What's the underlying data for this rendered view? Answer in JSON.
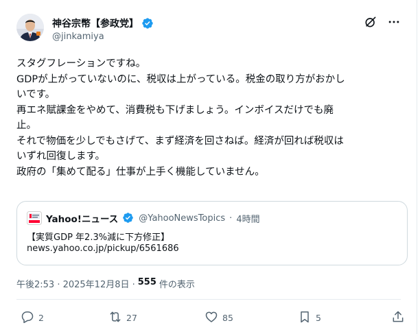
{
  "author": {
    "display_name": "神谷宗幣【参政党】",
    "handle": "@jinkamiya"
  },
  "tweet": {
    "lines": [
      "スタグフレーションですね。",
      "GDPが上がっていないのに、税収は上がっている。税金の取り方がおかし",
      "いです。",
      "再エネ賦課金をやめて、消費税も下げましょう。インボイスだけでも廃",
      "止。",
      "それで物価を少しでもさげて、まず経済を回さねば。経済が回れば税収は",
      "いずれ回復します。",
      "政府の「集めて配る」仕事が上手く機能していません。"
    ]
  },
  "quote": {
    "name": "Yahoo!ニュース",
    "handle": "@YahooNewsTopics",
    "separator": "·",
    "time": "4時間",
    "headline": "【実質GDP 年2.3%減に下方修正】",
    "link": "news.yahoo.co.jp/pickup/6561686"
  },
  "meta": {
    "timestamp": "午後2:53 · 2025年12月8日 ·",
    "views_count": "555",
    "views_label": "件の表示"
  },
  "actions": {
    "replies": "2",
    "reposts": "27",
    "likes": "85",
    "bookmarks": "5"
  },
  "icons": {
    "verified": "verified-badge-icon",
    "grok": "grok-icon",
    "more": "more-icon",
    "reply": "reply-icon",
    "repost": "repost-icon",
    "like": "heart-icon",
    "bookmark": "bookmark-icon",
    "share": "share-icon"
  },
  "colors": {
    "text": "#0f1419",
    "secondary": "#536471",
    "verified": "#1d9bf0",
    "border": "#cfd9de",
    "yahoo_red": "#ff0033"
  }
}
